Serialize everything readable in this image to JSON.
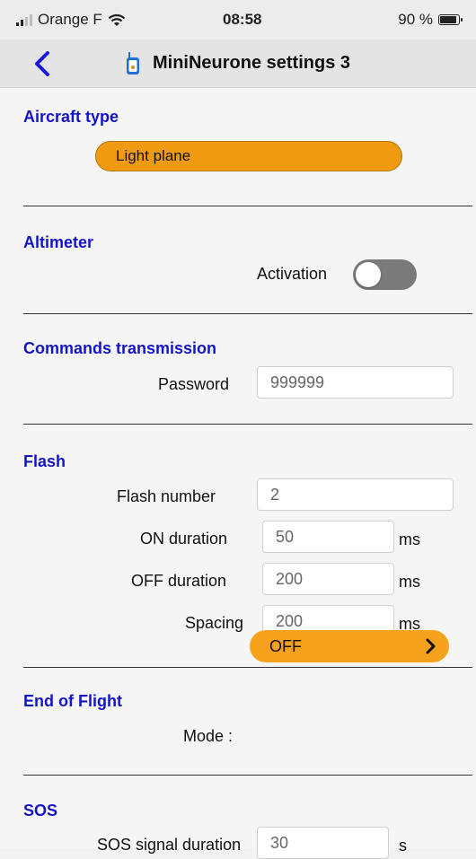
{
  "status_bar": {
    "carrier": "Orange F",
    "time": "08:58",
    "battery": "90 %",
    "battery_level": 0.9
  },
  "nav": {
    "title": "MiniNeurone settings 3",
    "back_icon": "chevron-left-icon",
    "device_icon": "device-icon"
  },
  "aircraft_type": {
    "title": "Aircraft type",
    "value": "Light plane"
  },
  "altimeter": {
    "title": "Altimeter",
    "activation_label": "Activation",
    "activation_on": false
  },
  "commands": {
    "title": "Commands transmission",
    "password_label": "Password",
    "password_value": "999999"
  },
  "flash": {
    "title": "Flash",
    "number_label": "Flash number",
    "number_value": "2",
    "on_label": "ON duration",
    "on_value": "50",
    "off_label": "OFF duration",
    "off_value": "200",
    "spacing_label": "Spacing",
    "spacing_value": "200",
    "unit": "ms"
  },
  "end_of_flight": {
    "title": "End of Flight",
    "mode_label": "Mode :",
    "mode_value": "OFF"
  },
  "sos": {
    "title": "SOS",
    "signal_label": "SOS signal duration",
    "signal_value": "30",
    "unit": "s"
  },
  "colors": {
    "accent_blue": "#1414c8",
    "orange": "#ef9a10",
    "orange_mode": "#f6a21d",
    "toggle_off": "#7a7a7a"
  }
}
